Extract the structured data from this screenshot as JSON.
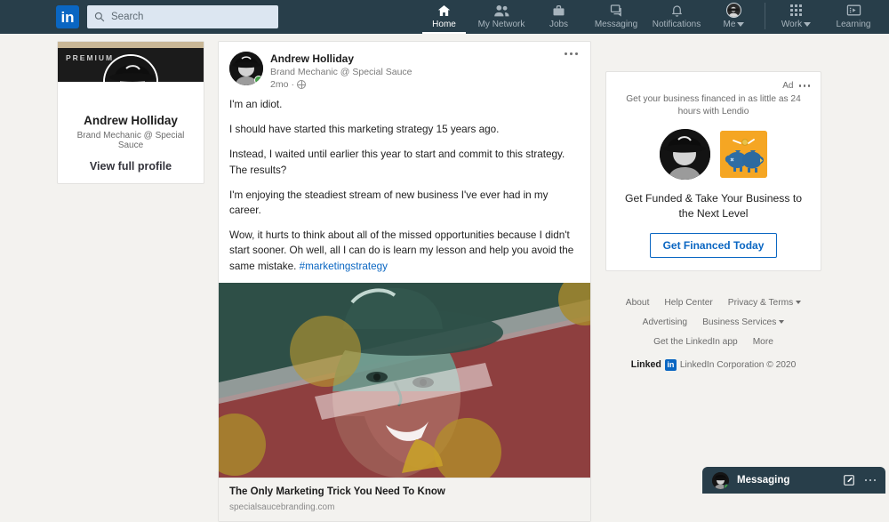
{
  "nav": {
    "logo_text": "in",
    "search_placeholder": "Search",
    "search_value": "",
    "search_icon": "search-icon",
    "items": [
      {
        "label": "Home",
        "icon": "home-icon",
        "active": true
      },
      {
        "label": "My Network",
        "icon": "people-icon",
        "active": false
      },
      {
        "label": "Jobs",
        "icon": "briefcase-icon",
        "active": false
      },
      {
        "label": "Messaging",
        "icon": "message-icon",
        "active": false
      },
      {
        "label": "Notifications",
        "icon": "bell-icon",
        "active": false
      },
      {
        "label": "Me",
        "icon": "avatar-icon",
        "active": false,
        "has_caret": true
      }
    ],
    "secondary_items": [
      {
        "label": "Work",
        "icon": "grid-icon",
        "has_caret": true
      },
      {
        "label": "Learning",
        "icon": "learning-icon",
        "has_caret": false
      }
    ]
  },
  "profile_card": {
    "premium_label": "PREMIUM",
    "name": "Andrew Holliday",
    "headline": "Brand Mechanic @ Special Sauce",
    "view_profile": "View full profile",
    "avatar_icon": "profile-avatar",
    "banner_color": "#1b1b1b",
    "banner_strip_color": "#c9b796"
  },
  "post": {
    "author": "Andrew Holliday",
    "headline": "Brand Mechanic @ Special Sauce",
    "timestamp": "2mo",
    "visibility_icon": "globe-icon",
    "menu_icon": "more-options-icon",
    "paragraphs": [
      "I'm an idiot.",
      "I should have started this marketing strategy 15 years ago.",
      "Instead, I waited until earlier this year to start and commit to this strategy. The results?",
      "I'm enjoying the steadiest stream of new business I've ever had in my career.",
      "Wow, it hurts to think about all of the missed opportunities because I didn't start sooner. Oh well, all I can do is learn my lesson and help you avoid the same mistake."
    ],
    "hashtag": "#marketingstrategy",
    "image_alt": "stylized-portrait-man-in-hat",
    "link_title": "The Only Marketing Trick You Need To Know",
    "link_url": "specialsaucebranding.com"
  },
  "ad": {
    "label": "Ad",
    "menu_icon": "more-options-icon",
    "subtext": "Get your business financed in as little as 24 hours with Lendio",
    "avatar_icon": "profile-avatar",
    "brand_icon": "piggy-banks-icon",
    "brand_bg": "#f5a623",
    "headline": "Get Funded & Take Your Business to the Next Level",
    "cta_label": "Get Financed Today",
    "cta_color": "#0a66c2"
  },
  "footer": {
    "row1": [
      "About",
      "Help Center",
      "Privacy & Terms"
    ],
    "row2": [
      "Advertising",
      "Business Services"
    ],
    "row3": [
      "Get the LinkedIn app",
      "More"
    ],
    "brand_word": "Linked",
    "brand_mark": "in",
    "copyright": "LinkedIn Corporation © 2020"
  },
  "messaging": {
    "title": "Messaging",
    "compose_icon": "compose-icon",
    "menu_icon": "more-options-icon",
    "avatar_icon": "profile-avatar"
  },
  "colors": {
    "nav_bg": "#283e4a",
    "page_bg": "#f3f2ef",
    "accent_blue": "#0a66c2",
    "card_bg": "#ffffff",
    "online_green": "#43a047"
  }
}
